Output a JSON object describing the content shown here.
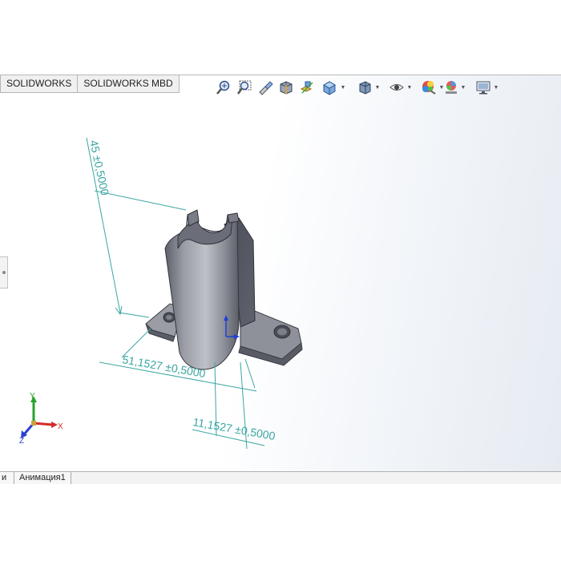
{
  "tabs": [
    {
      "label": "SOLIDWORKS"
    },
    {
      "label": "SOLIDWORKS MBD"
    }
  ],
  "heads_up_toolbar": [
    {
      "name": "zoom-to-fit-icon"
    },
    {
      "name": "zoom-to-area-icon"
    },
    {
      "name": "previous-view-icon"
    },
    {
      "name": "section-view-icon"
    },
    {
      "name": "dynamic-annotation-views-icon"
    },
    {
      "name": "view-orientation-icon"
    },
    {
      "name": "display-style-icon"
    },
    {
      "name": "hide-show-items-icon"
    },
    {
      "name": "edit-appearance-icon"
    },
    {
      "name": "apply-scene-icon"
    },
    {
      "name": "view-settings-icon"
    }
  ],
  "dimensions": {
    "height": "45 ±0,5000",
    "width": "51,1527 ±0,5000",
    "offset": "11,1527 ±0,5000"
  },
  "triad": {
    "x": "X",
    "y": "Y",
    "z": "Z"
  },
  "bottom_tabs": [
    {
      "label": "и"
    },
    {
      "label": "Анимация1"
    }
  ],
  "colors": {
    "dimension": "#3aa6a1",
    "model_body": "#8e909a",
    "viewport_bg_end": "#e6ebf2"
  }
}
